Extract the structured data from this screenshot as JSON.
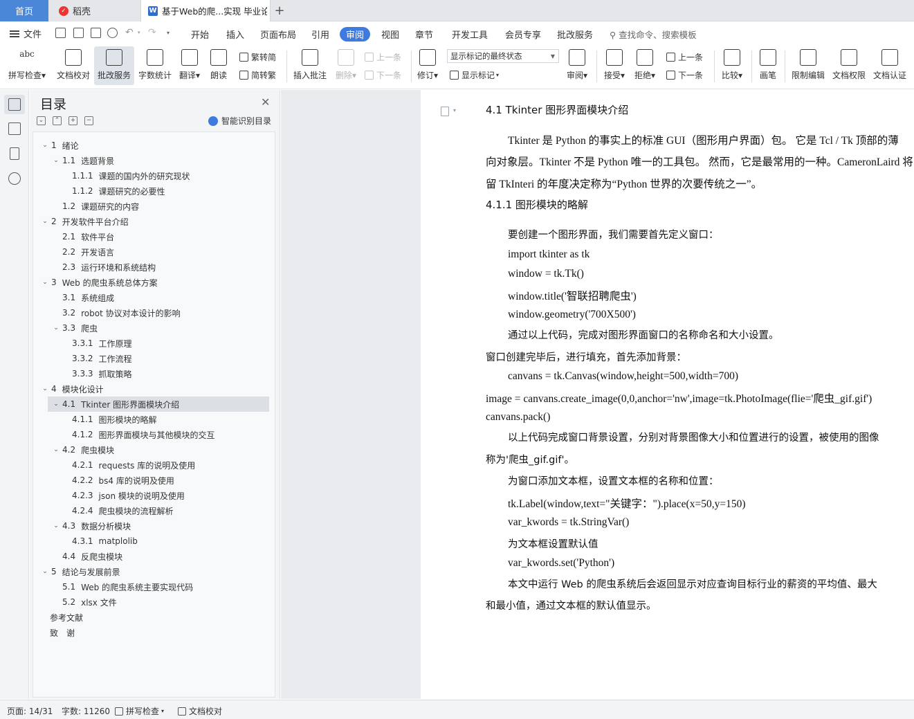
{
  "tabs": {
    "home": "首页",
    "daoke": "稻壳",
    "doc": "基于Web的爬...实现 毕业论文",
    "plus": "+"
  },
  "menu": {
    "file": "文件",
    "items": [
      "开始",
      "插入",
      "页面布局",
      "引用",
      "审阅",
      "视图",
      "章节",
      "开发工具",
      "会员专享",
      "批改服务"
    ],
    "active": "审阅",
    "search": "查找命令、搜索模板"
  },
  "ribbon": {
    "spell_icon_text": "abc",
    "spell": "拼写检查",
    "proof": "文档校对",
    "review_service": "批改服务",
    "word_count": "字数统计",
    "translate": "翻译",
    "read_aloud": "朗读",
    "to_traditional": "繁转简",
    "to_simplified": "简转繁",
    "insert_comment": "插入批注",
    "delete": "删除",
    "prev_comment": "上一条",
    "next_comment": "下一条",
    "track_changes": "修订",
    "markup_state": "显示标记的最终状态",
    "show_markup": "显示标记",
    "review": "审阅",
    "accept": "接受",
    "reject": "拒绝",
    "prev_change": "上一条",
    "next_change": "下一条",
    "compare": "比较",
    "pen": "画笔",
    "restrict": "限制编辑",
    "permission": "文档权限",
    "certify": "文档认证"
  },
  "toc": {
    "title": "目录",
    "smart": "智能识别目录",
    "items": [
      {
        "num": "1",
        "text": "绪论",
        "level": 0,
        "toggle": "v"
      },
      {
        "num": "1.1",
        "text": "选题背景",
        "level": 1,
        "toggle": "v"
      },
      {
        "num": "1.1.1",
        "text": "课题的国内外的研究现状",
        "level": 2,
        "toggle": ""
      },
      {
        "num": "1.1.2",
        "text": "课题研究的必要性",
        "level": 2,
        "toggle": ""
      },
      {
        "num": "1.2",
        "text": "课题研究的内容",
        "level": 1,
        "toggle": ""
      },
      {
        "num": "2",
        "text": "开发软件平台介绍",
        "level": 0,
        "toggle": "v"
      },
      {
        "num": "2.1",
        "text": "软件平台",
        "level": 1,
        "toggle": ""
      },
      {
        "num": "2.2",
        "text": "开发语言",
        "level": 1,
        "toggle": ""
      },
      {
        "num": "2.3",
        "text": "运行环境和系统结构",
        "level": 1,
        "toggle": ""
      },
      {
        "num": "3",
        "text": "Web 的爬虫系统总体方案",
        "level": 0,
        "toggle": "v"
      },
      {
        "num": "3.1",
        "text": "系统组成",
        "level": 1,
        "toggle": ""
      },
      {
        "num": "3.2",
        "text": "robot 协议对本设计的影响",
        "level": 1,
        "toggle": ""
      },
      {
        "num": "3.3",
        "text": "爬虫",
        "level": 1,
        "toggle": "v"
      },
      {
        "num": "3.3.1",
        "text": "工作原理",
        "level": 2,
        "toggle": ""
      },
      {
        "num": "3.3.2",
        "text": "工作流程",
        "level": 2,
        "toggle": ""
      },
      {
        "num": "3.3.3",
        "text": "抓取策略",
        "level": 2,
        "toggle": ""
      },
      {
        "num": "4",
        "text": "模块化设计",
        "level": 0,
        "toggle": "v"
      },
      {
        "num": "4.1",
        "text": "Tkinter 图形界面模块介绍",
        "level": 1,
        "toggle": "v",
        "selected": true
      },
      {
        "num": "4.1.1",
        "text": "图形模块的略解",
        "level": 2,
        "toggle": ""
      },
      {
        "num": "4.1.2",
        "text": "图形界面模块与其他模块的交互",
        "level": 2,
        "toggle": ""
      },
      {
        "num": "4.2",
        "text": "爬虫模块",
        "level": 1,
        "toggle": "v"
      },
      {
        "num": "4.2.1",
        "text": "requests 库的说明及使用",
        "level": 2,
        "toggle": ""
      },
      {
        "num": "4.2.2",
        "text": "bs4 库的说明及使用",
        "level": 2,
        "toggle": ""
      },
      {
        "num": "4.2.3",
        "text": "json 模块的说明及使用",
        "level": 2,
        "toggle": ""
      },
      {
        "num": "4.2.4",
        "text": "爬虫模块的流程解析",
        "level": 2,
        "toggle": ""
      },
      {
        "num": "4.3",
        "text": "数据分析模块",
        "level": 1,
        "toggle": "v"
      },
      {
        "num": "4.3.1",
        "text": "matplolib",
        "level": 2,
        "toggle": ""
      },
      {
        "num": "4.4",
        "text": "反爬虫模块",
        "level": 1,
        "toggle": ""
      },
      {
        "num": "5",
        "text": "结论与发展前景",
        "level": 0,
        "toggle": "v"
      },
      {
        "num": "5.1",
        "text": "Web 的爬虫系统主要实现代码",
        "level": 1,
        "toggle": ""
      },
      {
        "num": "5.2",
        "text": "xlsx 文件",
        "level": 1,
        "toggle": ""
      },
      {
        "num": "",
        "text": "参考文献",
        "level": -1,
        "toggle": ""
      },
      {
        "num": "",
        "text": "致　谢",
        "level": -1,
        "toggle": ""
      }
    ]
  },
  "doc": {
    "lines": [
      "4.1  Tkinter 图形界面模块介绍",
      "Tkinter 是 Python 的事实上的标准 GUI（图形用户界面）包。 它是 Tcl / Tk 顶部的薄",
      "向对象层。Tkinter 不是 Python 唯一的工具包。 然而，它是最常用的一种。CameronLaird 将",
      "留 TkInteri 的年度决定称为“Python 世界的次要传统之一”。",
      "4.1.1  图形模块的略解",
      "要创建一个图形界面，我们需要首先定义窗口：",
      "import tkinter as tk",
      "window = tk.Tk()",
      "window.title('智联招聘爬虫')",
      "window.geometry('700X500')",
      "通过以上代码，完成对图形界面窗口的名称命名和大小设置。",
      "窗口创建完毕后，进行填充，首先添加背景：",
      "canvans = tk.Canvas(window,height=500,width=700)",
      "image = canvans.create_image(0,0,anchor='nw',image=tk.PhotoImage(flie='爬虫_gif.gif')",
      "canvans.pack()",
      "以上代码完成窗口背景设置，分别对背景图像大小和位置进行的设置，被使用的图像",
      "称为'爬虫_gif.gif'。",
      "为窗口添加文本框，设置文本框的名称和位置：",
      "tk.Label(window,text=\"关键字：\").place(x=50,y=150)",
      "var_kwords = tk.StringVar()",
      "为文本框设置默认值",
      "var_kwords.set('Python')",
      "本文中运行 Web 的爬虫系统后会返回显示对应查询目标行业的薪资的平均值、最大",
      "和最小值，通过文本框的默认值显示。"
    ]
  },
  "status": {
    "page": "页面: 14/31",
    "words": "字数: 11260",
    "spell": "拼写检查",
    "proof": "文档校对"
  }
}
